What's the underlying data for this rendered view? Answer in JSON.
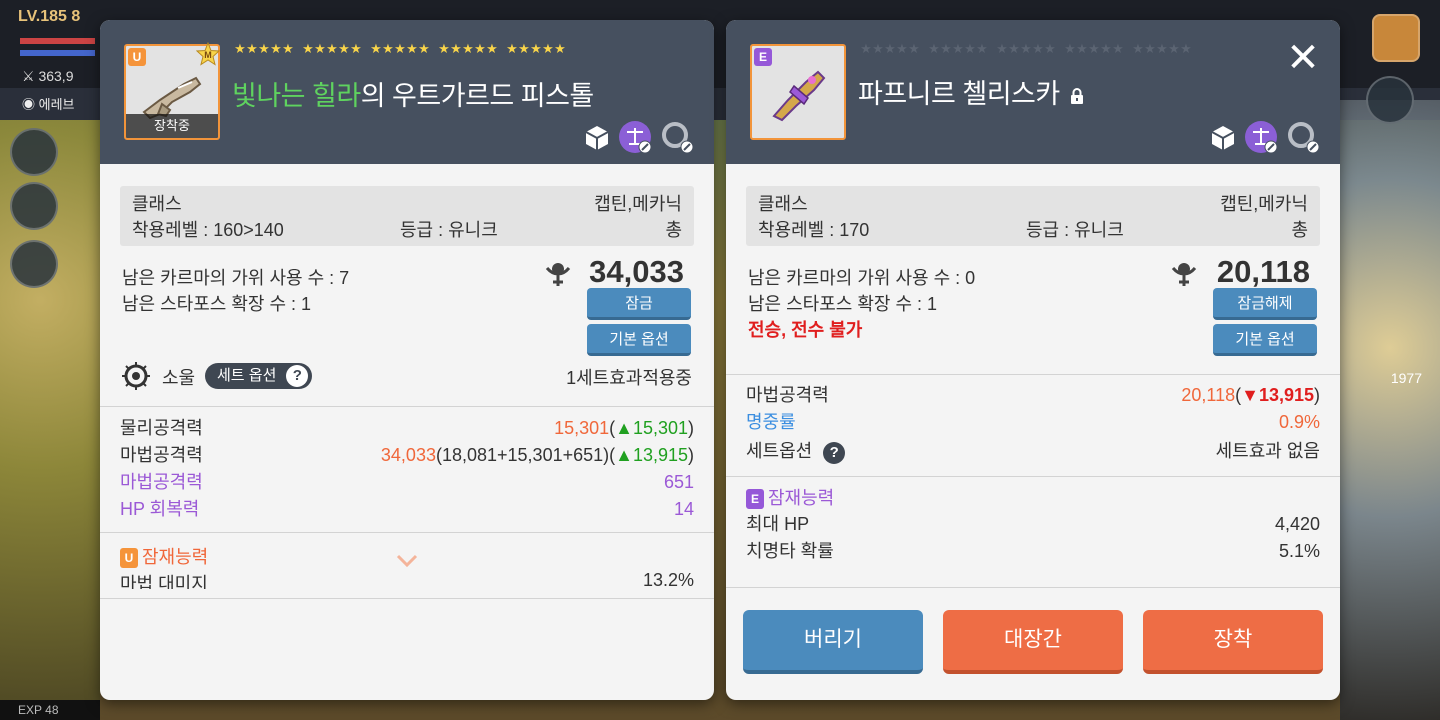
{
  "background": {
    "level": "LV.185 8",
    "power": "363,9",
    "place": "에레브",
    "exp_label": "EXP",
    "exp_value": "48",
    "right_number": "1977"
  },
  "left": {
    "grade": "U",
    "master_badge": "M",
    "equipped_label": "장착중",
    "title_highlight": "빛나는 힐라",
    "title_rest": "의 우트가르드 피스톨",
    "stars_filled": 25,
    "stars_total": 25,
    "info": {
      "class_label": "클래스",
      "class_value": "캡틴,메카닉",
      "level_label": "착용레벨 :  160>140",
      "grade_label": "등급 :  유니크",
      "type_value": "총"
    },
    "karma_text": "남은 카르마의 가위 사용 수 :  7",
    "starforce_text": "남은 스타포스 확장 수 : 1",
    "combat_power": "34,033",
    "lock_button": "잠금",
    "base_option_button": "기본 옵션",
    "soul_label": "소울",
    "set_option_label": "세트 옵션",
    "set_effect_status": "1세트효과적용중",
    "stats": [
      {
        "label": "물리공격력",
        "value": "15,301",
        "open": "(",
        "delta": "▲15,301",
        "close": ")",
        "style": "normal"
      },
      {
        "label": "마법공격력",
        "value": "34,033",
        "open": "(18,081+15,301+651)(",
        "delta": "▲13,915",
        "close": ")",
        "style": "normal"
      },
      {
        "label": "마법공격력",
        "value": "651",
        "style": "purple"
      },
      {
        "label": "HP 회복력",
        "value": "14",
        "style": "purple"
      }
    ],
    "potential_badge": "U",
    "potential_title": "잠재능력",
    "potential_first_label": "마법 대미지",
    "potential_first_value": "13.2%"
  },
  "right": {
    "grade": "E",
    "title": "파프니르 첼리스카",
    "stars_filled": 0,
    "stars_total": 25,
    "close_label": "✕",
    "info": {
      "class_label": "클래스",
      "class_value": "캡틴,메카닉",
      "level_label": "착용레벨 :  170",
      "grade_label": "등급 :  유니크",
      "type_value": "총"
    },
    "karma_text": "남은 카르마의 가위 사용 수 :  0",
    "starforce_text": "남은 스타포스 확장 수 : 1",
    "transfer_text": "전승, 전수 불가",
    "combat_power": "20,118",
    "unlock_button": "잠금해제",
    "base_option_button": "기본 옵션",
    "stats": [
      {
        "label": "마법공격력",
        "value": "20,118",
        "open": "(",
        "delta": "▼13,915",
        "close": ")"
      },
      {
        "label": "명중률",
        "value": "0.9%"
      },
      {
        "label": "세트옵션",
        "value": "세트효과 없음"
      }
    ],
    "potential_badge": "E",
    "potential_title": "잠재능력",
    "potentials": [
      {
        "label": "최대 HP",
        "value": "4,420"
      },
      {
        "label": "치명타 확률",
        "value": "5.1%"
      }
    ],
    "buttons": {
      "discard": "버리기",
      "blacksmith": "대장간",
      "equip": "장착"
    }
  },
  "colors": {
    "header": "#46505f",
    "panel": "#f4f4f4",
    "blue_button": "#4b8bbd",
    "orange_button": "#ee6d45",
    "star": "#f8d44a",
    "value_orange": "#f0673a",
    "up_green": "#20a020",
    "down_red": "#e01e1e",
    "purple": "#9b59d6"
  }
}
